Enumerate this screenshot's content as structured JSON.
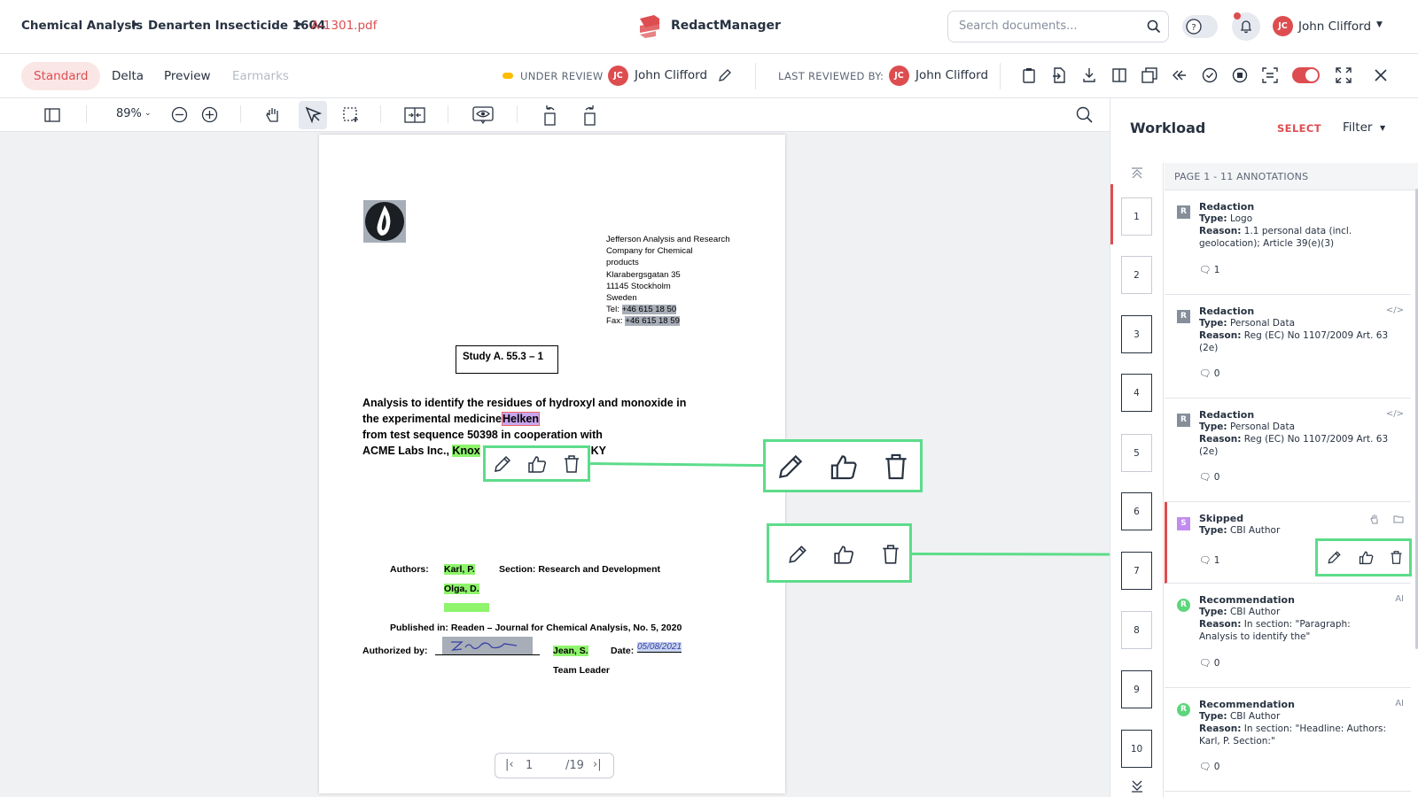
{
  "breadcrumb": [
    "Chemical Analysis",
    "Denarten Insecticide 1604",
    "A-1301.pdf"
  ],
  "brand": "RedactManager",
  "search": {
    "placeholder": "Search documents..."
  },
  "user": {
    "initials": "JC",
    "name": "John Clifford"
  },
  "tabs": [
    "Standard",
    "Delta",
    "Preview",
    "Earmarks"
  ],
  "status": {
    "label": "UNDER REVIEW",
    "reviewer": "John Clifford",
    "last_reviewed_label": "LAST REVIEWED BY:",
    "last_reviewer": "John Clifford"
  },
  "toolbar": {
    "zoom": "89%"
  },
  "document": {
    "address": [
      "Jefferson Analysis and Research",
      "Company for Chemical",
      "products",
      "Klarabergsgatan 35",
      "11145 Stockholm",
      "Sweden"
    ],
    "tel_label": "Tel:",
    "tel": "+46 615 18 50",
    "fax_label": "Fax:",
    "fax": "+46 615 18 59",
    "study": "Study A. 55.3 – 1",
    "title_l1": "Analysis to identify the residues of hydroxyl and monoxide in",
    "title_l2": "the experimental medicine",
    "title_l2_hl": "Helken",
    "title_l3": "from test sequence 50398 in cooperation with",
    "title_l4": "ACME Labs Inc.,",
    "title_l4_hl": "Knox",
    "title_l4_end": ", KY",
    "authors_label": "Authors:",
    "author1": "Karl, P.",
    "author2": "Olga, D.",
    "section": "Section: Research and Development",
    "published": "Published in: Readen – Journal for Chemical Analysis, No. 5, 2020",
    "authorized_label": "Authorized by:",
    "signer": "Jean, S.",
    "date_label": "Date:",
    "date_value": "05/08/2021",
    "team_leader": "Team Leader"
  },
  "pager": {
    "current": "1",
    "total": "/19"
  },
  "panel": {
    "title": "Workload",
    "select": "SELECT",
    "filter": "Filter",
    "page_header": "PAGE 1 - 11 ANNOTATIONS",
    "thumbs": [
      "1",
      "2",
      "3",
      "4",
      "5",
      "6",
      "7",
      "8",
      "9",
      "10"
    ],
    "annotations": [
      {
        "badge": "R",
        "title": "Redaction",
        "type_label": "Type:",
        "type": "Logo",
        "reason_label": "Reason:",
        "reason": "1.1 personal data (incl. geolocation); Article 39(e)(3)",
        "comments": "1",
        "tag": ""
      },
      {
        "badge": "R",
        "title": "Redaction",
        "type_label": "Type:",
        "type": "Personal Data",
        "reason_label": "Reason:",
        "reason": "Reg (EC) No 1107/2009 Art. 63 (2e)",
        "comments": "0",
        "tag": "</>"
      },
      {
        "badge": "R",
        "title": "Redaction",
        "type_label": "Type:",
        "type": "Personal Data",
        "reason_label": "Reason:",
        "reason": "Reg (EC) No 1107/2009 Art. 63 (2e)",
        "comments": "0",
        "tag": "</>"
      },
      {
        "badge": "S",
        "title": "Skipped",
        "type_label": "Type:",
        "type": "CBI Author",
        "reason_label": "",
        "reason": "",
        "comments": "1",
        "tag": ""
      },
      {
        "badge": "R",
        "title": "Recommendation",
        "type_label": "Type:",
        "type": "CBI Author",
        "reason_label": "Reason:",
        "reason": "In section: \"Paragraph: Analysis to identify the\"",
        "comments": "0",
        "tag": "AI"
      },
      {
        "badge": "R",
        "title": "Recommendation",
        "type_label": "Type:",
        "type": "CBI Author",
        "reason_label": "Reason:",
        "reason": "In section: \"Headline: Authors: Karl, P. Section:\"",
        "comments": "0",
        "tag": "AI"
      }
    ]
  },
  "colors": {
    "accent": "#dd4d50",
    "highlight_green": "#8ef46c",
    "callout": "#5cdc8a",
    "skipped": "#c18cf0",
    "recommendation": "#5cd67b"
  }
}
